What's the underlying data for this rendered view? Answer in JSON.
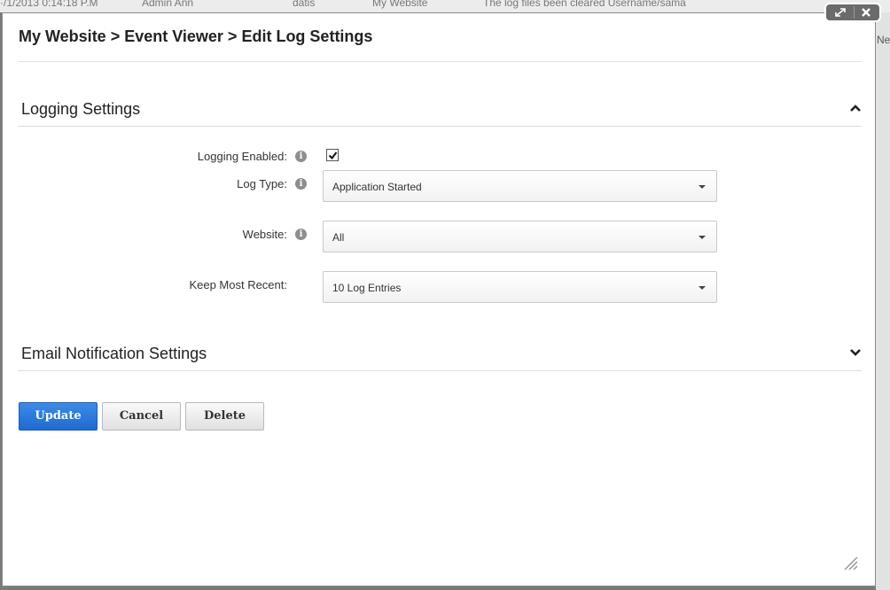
{
  "background": {
    "top_fragments": [
      "·/1/2013 0:14:18 P.M",
      "Admin Ann",
      "datis",
      "My Website",
      "The log files been cleared Username/sama"
    ],
    "right_fragment": "Ne"
  },
  "modal": {
    "breadcrumb": "My Website > Event Viewer > Edit Log Settings"
  },
  "logging_section": {
    "title": "Logging Settings",
    "expanded": true,
    "fields": {
      "logging_enabled": {
        "label": "Logging Enabled:",
        "checked": true
      },
      "log_type": {
        "label": "Log Type:",
        "value": "Application Started"
      },
      "website": {
        "label": "Website:",
        "value": "All"
      },
      "keep_recent": {
        "label": "Keep Most Recent:",
        "value": "10 Log Entries"
      }
    }
  },
  "email_section": {
    "title": "Email Notification Settings",
    "expanded": false
  },
  "buttons": {
    "update": "Update",
    "cancel": "Cancel",
    "delete": "Delete"
  },
  "icons": {
    "info": "i",
    "collapse": "chevron-up-icon",
    "expand": "chevron-down-icon",
    "window_expand": "expand-arrows-icon",
    "window_close": "close-x-icon",
    "resize": "resize-grip-icon"
  },
  "colors": {
    "primary_button": "#1f6ad1",
    "text": "#222222"
  }
}
